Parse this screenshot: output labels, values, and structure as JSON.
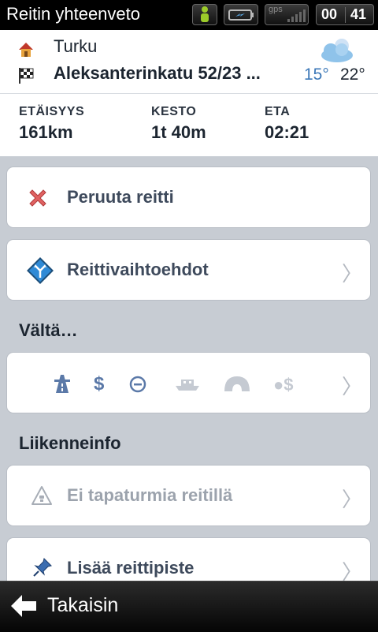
{
  "statusbar": {
    "title": "Reitin yhteenveto",
    "gps_label": "gps",
    "clock_hours": "00",
    "clock_minutes": "41"
  },
  "route": {
    "origin": "Turku",
    "destination": "Aleksanterinkatu 52/23   ...",
    "temp_low": "15°",
    "temp_high": "22°"
  },
  "stats": [
    {
      "label": "ETÄISYYS",
      "value": "161km"
    },
    {
      "label": "KESTO",
      "value": "1t 40m"
    },
    {
      "label": "ETA",
      "value": "02:21"
    }
  ],
  "menu": {
    "cancel_route": "Peruuta reitti",
    "route_options": "Reittivaihtoehdot",
    "avoid_header": "Vältä…",
    "traffic_header": "Liikenneinfo",
    "no_incidents": "Ei tapaturmia reitillä",
    "add_waypoint": "Lisää reittipiste"
  },
  "avoid_icons": [
    "motorway-icon",
    "toll-icon",
    "no-entry-icon",
    "ferry-icon",
    "tunnel-icon",
    "toll-road-icon"
  ],
  "bottombar": {
    "back_label": "Takaisin"
  },
  "colors": {
    "accent_blue": "#3c78b8",
    "background": "#c7ccd3",
    "text_dark": "#1c2530"
  }
}
